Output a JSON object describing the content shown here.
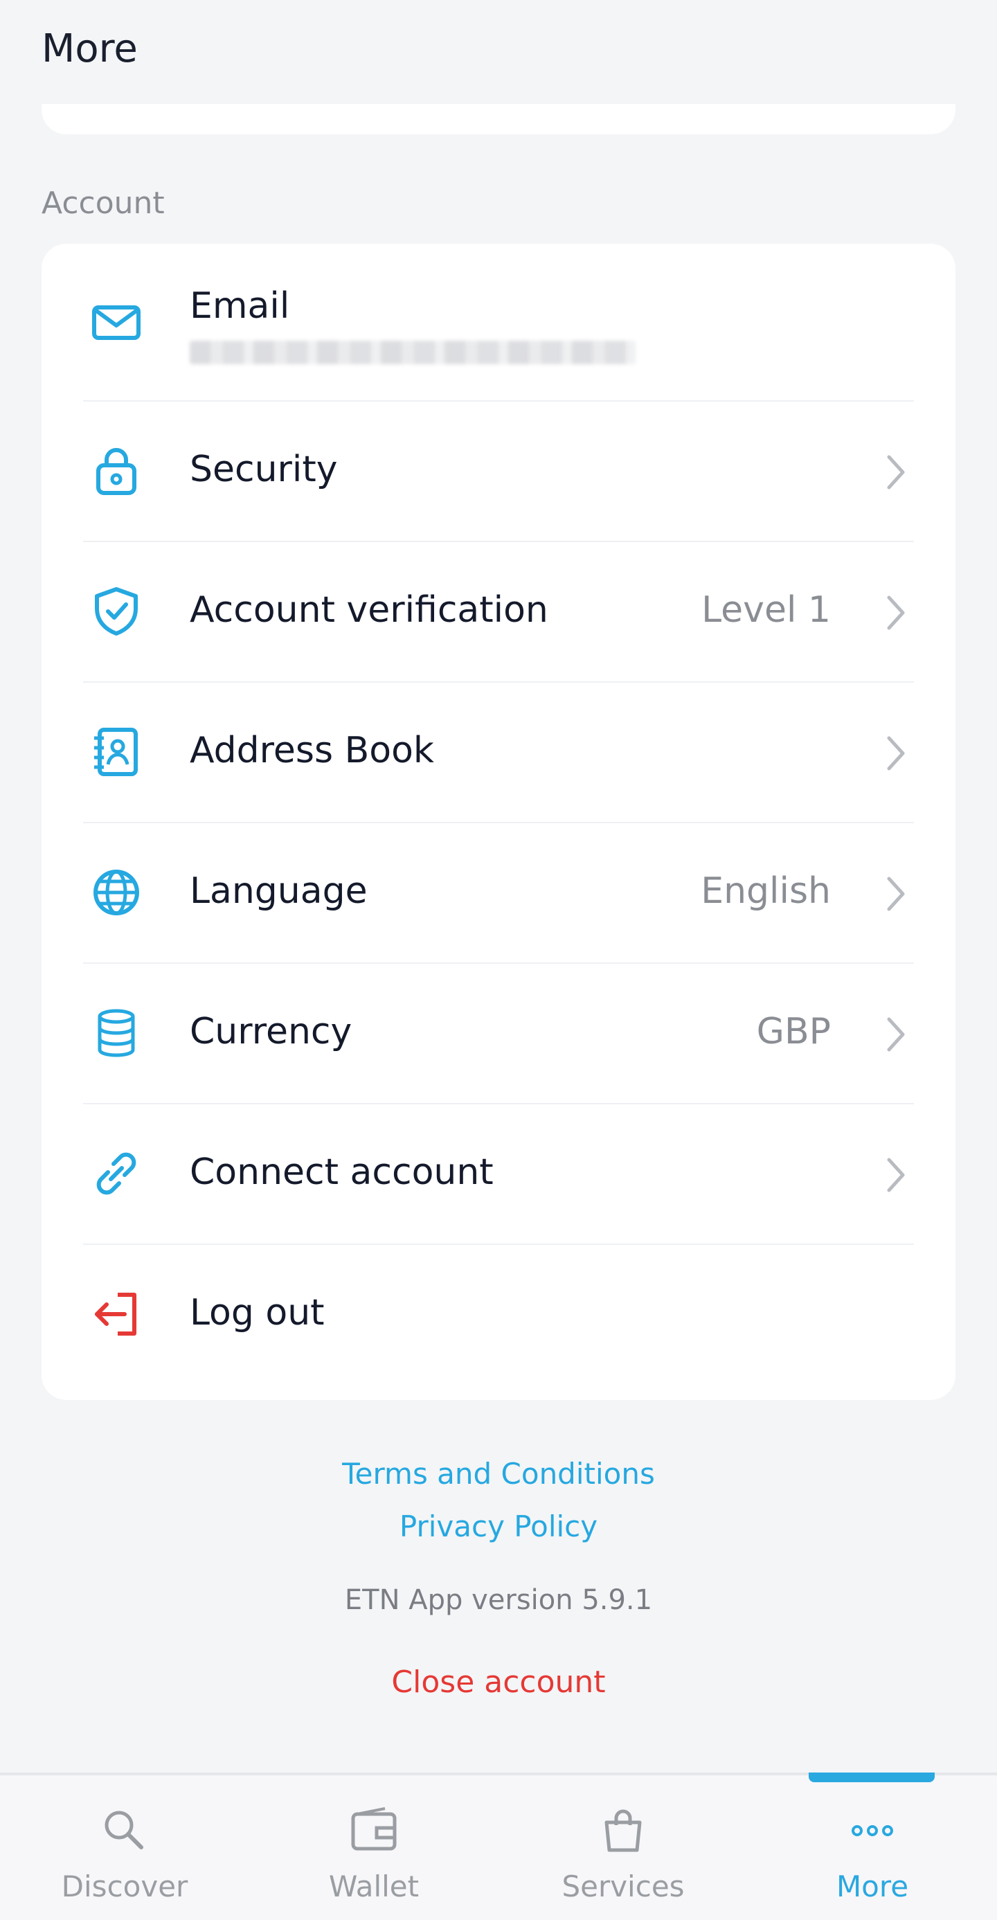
{
  "header": {
    "title": "More"
  },
  "account": {
    "section_label": "Account",
    "email": {
      "label": "Email"
    },
    "rows": [
      {
        "label": "Security",
        "value": ""
      },
      {
        "label": "Account verification",
        "value": "Level 1"
      },
      {
        "label": "Address Book",
        "value": ""
      },
      {
        "label": "Language",
        "value": "English"
      },
      {
        "label": "Currency",
        "value": "GBP"
      },
      {
        "label": "Connect account",
        "value": ""
      }
    ],
    "logout": {
      "label": "Log out"
    }
  },
  "footer": {
    "terms": "Terms and Conditions",
    "privacy": "Privacy Policy",
    "version": "ETN App version 5.9.1",
    "close_account": "Close account"
  },
  "tabs": [
    {
      "label": "Discover",
      "icon": "search-icon"
    },
    {
      "label": "Wallet",
      "icon": "wallet-icon"
    },
    {
      "label": "Services",
      "icon": "shopping-bag-icon"
    },
    {
      "label": "More",
      "icon": "more-dots-icon",
      "active": true
    }
  ],
  "colors": {
    "accent": "#26a8e0",
    "danger": "#e53935",
    "text": "#141a2b",
    "muted": "#8a8d93",
    "background": "#f4f5f7"
  }
}
